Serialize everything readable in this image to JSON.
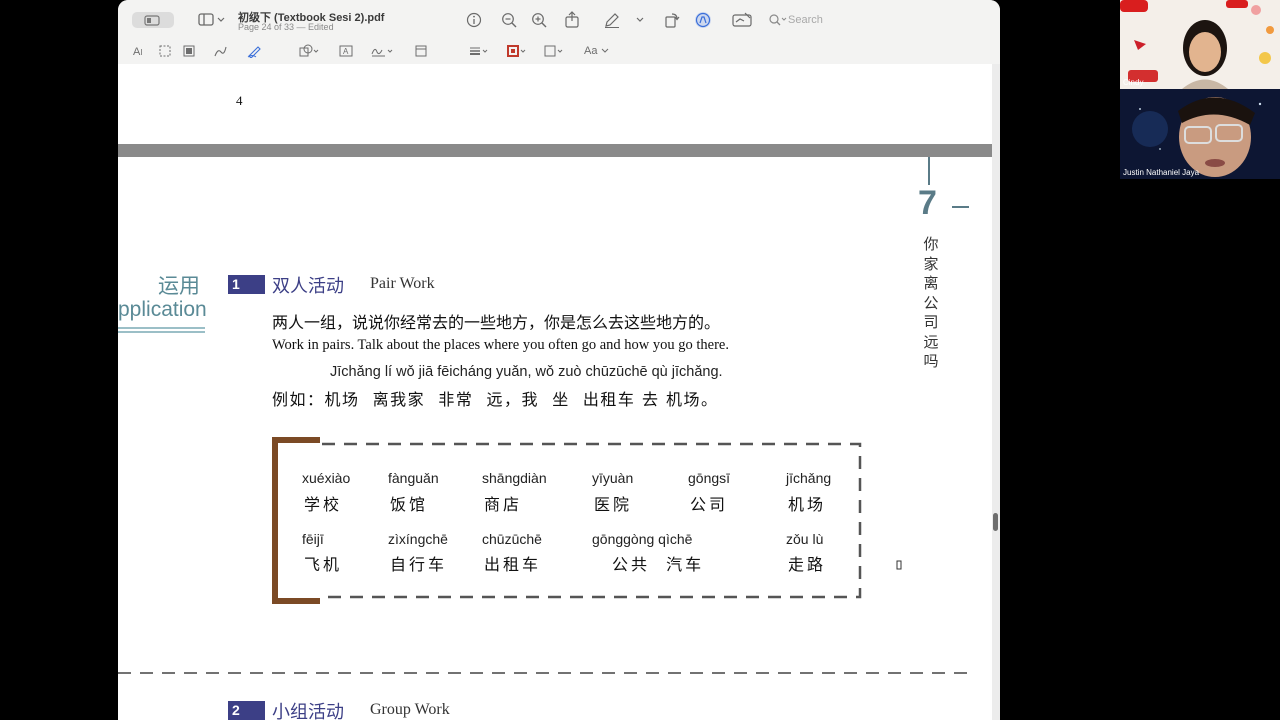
{
  "window": {
    "doc_title": "初级下 (Textbook Sesi 2).pdf",
    "doc_subtitle": "Page 24 of 33 — Edited",
    "search_placeholder": "Search"
  },
  "toolbar": {
    "icons": [
      "sidebar-toggle-icon",
      "info-icon",
      "zoom-out-icon",
      "zoom-in-icon",
      "share-icon",
      "highlight-pen-icon",
      "rotate-icon",
      "markup-icon",
      "annotation-form-icon",
      "search-icon"
    ]
  },
  "markup_toolbar": {
    "text_selection_label": "A",
    "font_label": "Aa"
  },
  "prev_page": {
    "page_number": "4"
  },
  "page": {
    "chapter_number": "7",
    "chapter_title_chars": [
      "你",
      "家",
      "离",
      "公",
      "司",
      "远",
      "吗"
    ],
    "section_label_cn": "运用",
    "section_label_en": "pplication",
    "activity1": {
      "number": "1",
      "title_cn": "双人活动",
      "title_en": "Pair Work",
      "instruction_cn": "两人一组，说说你经常去的一些地方，你是怎么去这些地方的。",
      "instruction_en": "Work in pairs. Talk about the places where you often go and how you go there.",
      "example_pinyin": "Jīchǎng lí wǒ jiā fēicháng yuǎn, wǒ zuò chūzūchē qù jīchǎng.",
      "example_cn": "例如：机场  离我家  非常  远，我  坐  出租车 去 机场。"
    },
    "vocab": [
      {
        "pinyin": "xuéxiào",
        "hanzi": "学校"
      },
      {
        "pinyin": "fànguǎn",
        "hanzi": "饭馆"
      },
      {
        "pinyin": "shāngdiàn",
        "hanzi": "商店"
      },
      {
        "pinyin": "yīyuàn",
        "hanzi": "医院"
      },
      {
        "pinyin": "gōngsī",
        "hanzi": "公司"
      },
      {
        "pinyin": "jīchǎng",
        "hanzi": "机场"
      },
      {
        "pinyin": "fēijī",
        "hanzi": "飞机"
      },
      {
        "pinyin": "zìxíngchē",
        "hanzi": "自行车"
      },
      {
        "pinyin": "chūzūchē",
        "hanzi": "出租车"
      },
      {
        "pinyin": "gōnggòng qìchē",
        "hanzi": "公共  汽车"
      },
      {
        "pinyin": "zǒu lù",
        "hanzi": "走路"
      }
    ],
    "activity2": {
      "number": "2",
      "title_cn": "小组活动",
      "title_en": "Group Work"
    }
  },
  "participants": [
    {
      "name": "Cindy"
    },
    {
      "name": "Justin Nathaniel Jaya"
    }
  ],
  "colors": {
    "accent_blue": "#3c3f86",
    "bracket_brown": "#7b4a25",
    "section_teal": "#5a8a96"
  }
}
